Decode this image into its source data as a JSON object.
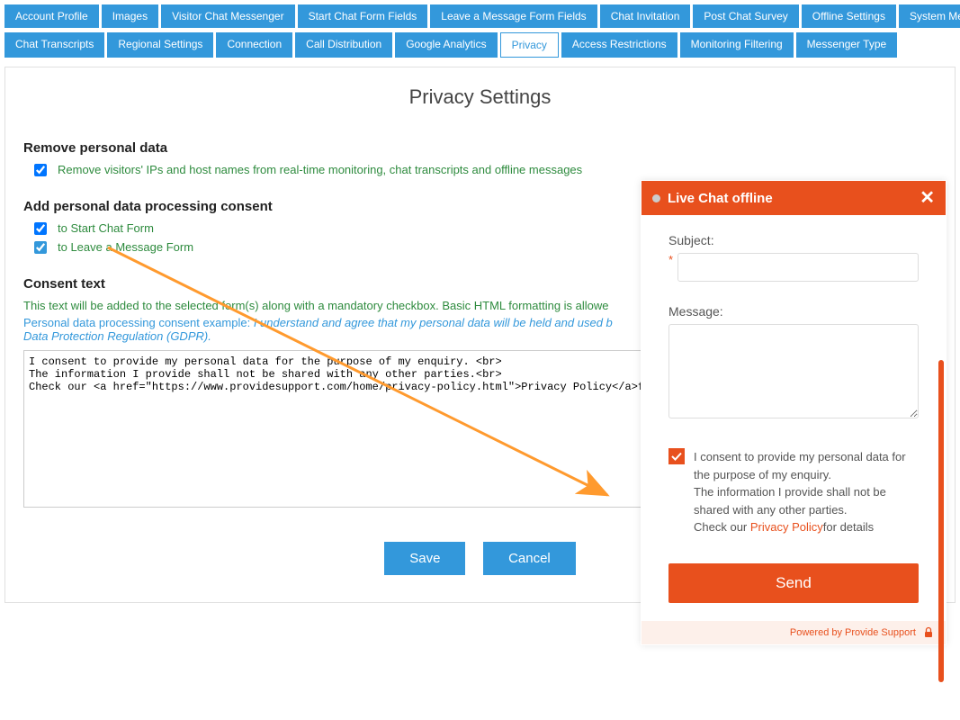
{
  "tabs_row1": [
    "Account Profile",
    "Images",
    "Visitor Chat Messenger",
    "Start Chat Form Fields",
    "Leave a Message Form Fields",
    "Chat Invitation",
    "Post Chat Survey",
    "Offline Settings",
    "System Messages"
  ],
  "tabs_row2": [
    {
      "label": "Chat Transcripts",
      "active": false
    },
    {
      "label": "Regional Settings",
      "active": false
    },
    {
      "label": "Connection",
      "active": false
    },
    {
      "label": "Call Distribution",
      "active": false
    },
    {
      "label": "Google Analytics",
      "active": false
    },
    {
      "label": "Privacy",
      "active": true
    },
    {
      "label": "Access Restrictions",
      "active": false
    },
    {
      "label": "Monitoring Filtering",
      "active": false
    },
    {
      "label": "Messenger Type",
      "active": false
    }
  ],
  "page_title": "Privacy Settings",
  "remove": {
    "title": "Remove personal data",
    "opt1": "Remove visitors' IPs and host names from real-time monitoring, chat transcripts and offline messages"
  },
  "add_consent": {
    "title": "Add personal data processing consent",
    "opt1": "to Start Chat Form",
    "opt2": "to Leave a Message Form"
  },
  "consent_text": {
    "title": "Consent text",
    "desc": "This text will be added to the selected form(s) along with a mandatory checkbox. Basic HTML formatting is allowe",
    "example_prefix": "Personal data processing consent example: ",
    "example_italic": "I understand and agree that my personal data will be held and used b",
    "example_suffix": "Data Protection Regulation (GDPR).",
    "textarea": "I consent to provide my personal data for the purpose of my enquiry. <br>\nThe information I provide shall not be shared with any other parties.<br>\nCheck our <a href=\"https://www.providesupport.com/home/privacy-policy.html\">Privacy Policy</a>for detai"
  },
  "buttons": {
    "save": "Save",
    "cancel": "Cancel"
  },
  "chat": {
    "header": "Live Chat offline",
    "subject_label": "Subject:",
    "message_label": "Message:",
    "consent_line1": "I consent to provide my personal data for the purpose of my enquiry.",
    "consent_line2": "The information I provide shall not be shared with any other parties.",
    "consent_line3a": "Check our ",
    "consent_link": "Privacy Policy",
    "consent_line3b": "for details",
    "send": "Send",
    "footer": "Powered by Provide Support"
  }
}
